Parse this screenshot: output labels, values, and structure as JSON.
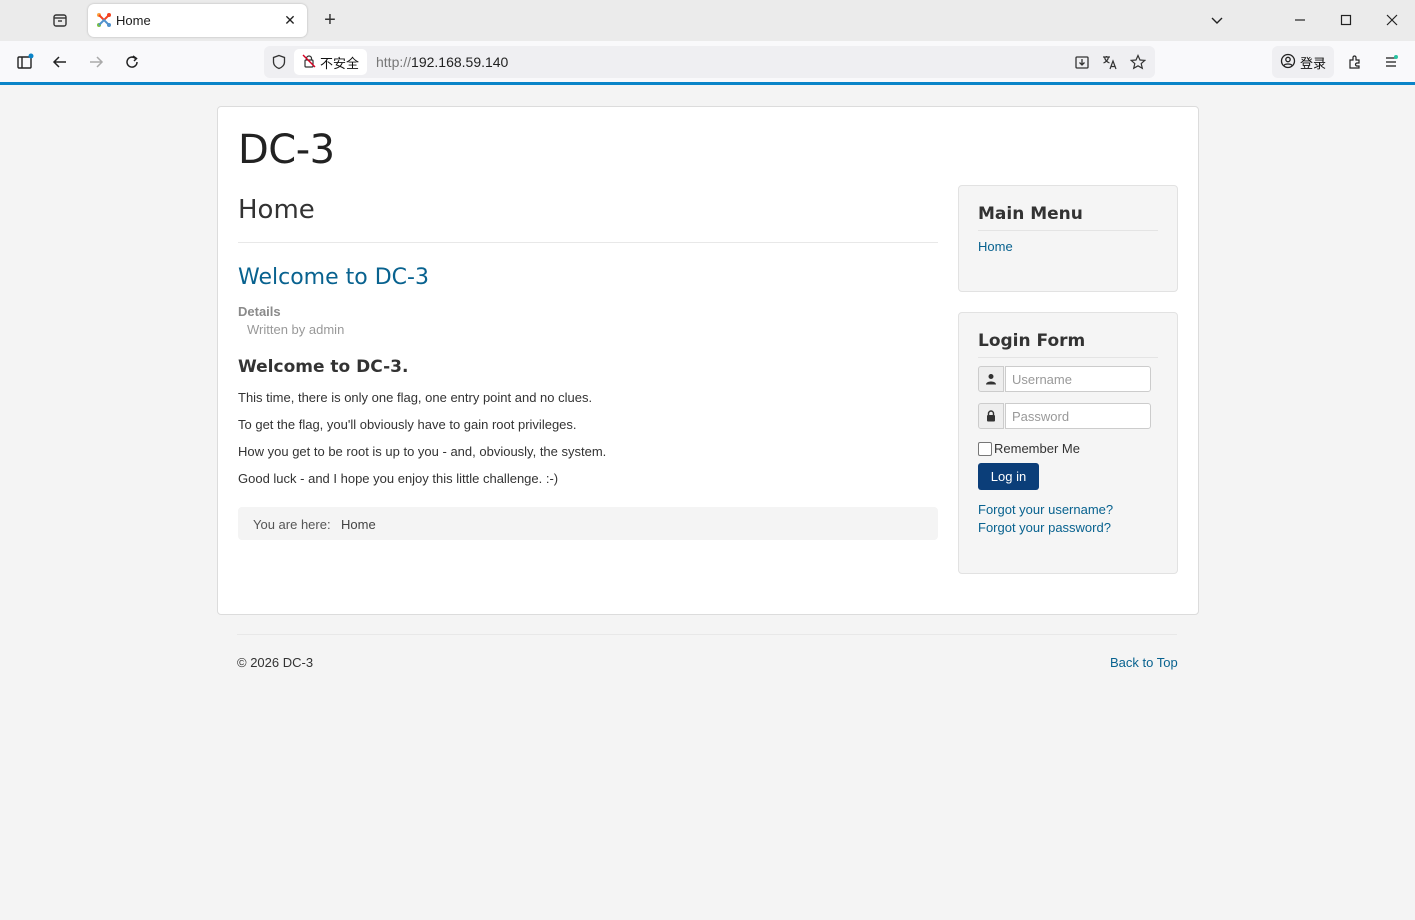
{
  "browser": {
    "tab": {
      "title": "Home",
      "favicon": "joomla-icon"
    },
    "address": {
      "security_label": "不安全",
      "url_protocol": "http://",
      "url_host": "192.168.59.140"
    },
    "account_label": "登录"
  },
  "page": {
    "site_title": "DC-3",
    "heading": "Home",
    "article": {
      "title": "Welcome to DC-3",
      "details_label": "Details",
      "written_by": "Written by admin",
      "heading": "Welcome to DC-3.",
      "paragraphs": [
        "This time, there is only one flag, one entry point and no clues.",
        "To get the flag, you'll obviously have to gain root privileges.",
        "How you get to be root is up to you - and, obviously, the system.",
        "Good luck - and I hope you enjoy this little challenge.  :-)"
      ]
    },
    "breadcrumb": {
      "label": "You are here:",
      "current": "Home"
    },
    "main_menu": {
      "title": "Main Menu",
      "items": [
        "Home"
      ]
    },
    "login_form": {
      "title": "Login Form",
      "username_placeholder": "Username",
      "password_placeholder": "Password",
      "remember_label": "Remember Me",
      "login_button": "Log in",
      "forgot_username": "Forgot your username?",
      "forgot_password": "Forgot your password?"
    },
    "footer": {
      "copyright": "© 2026 DC-3",
      "back_to_top": "Back to Top"
    }
  },
  "colors": {
    "accent": "#0a84c8",
    "link": "#08628f",
    "button": "#0b3e79"
  }
}
